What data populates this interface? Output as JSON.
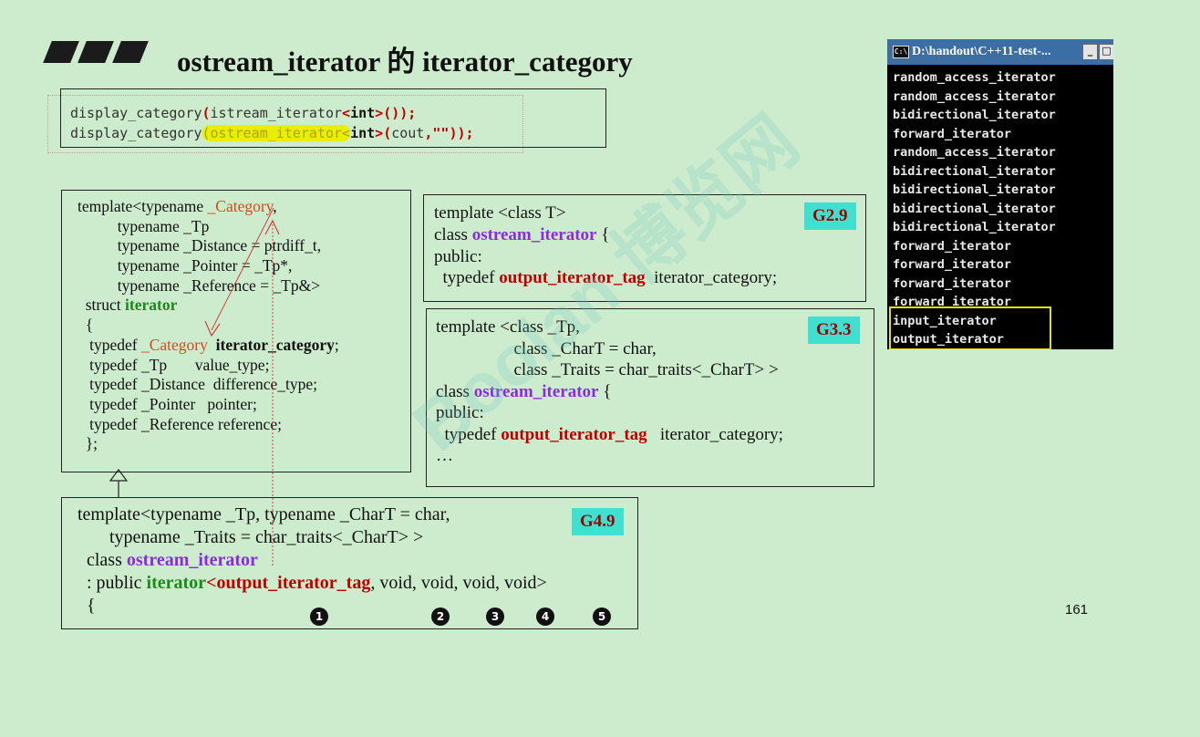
{
  "header": {
    "title": "ostream_iterator 的 iterator_category"
  },
  "calls": {
    "line1": {
      "fn": "display_category",
      "open": "(",
      "type": "istream_iterator",
      "lt": "<",
      "arg": "int",
      "gt": ">",
      "rest": "());"
    },
    "line2": {
      "fn": "display_category",
      "open": "(",
      "type": "ostream_iterator",
      "lt": "<",
      "arg": "int",
      "gt": ">",
      "p1": "(",
      "cout": "cout",
      "comma": ",",
      "str": "\"\"",
      "close": "));"
    }
  },
  "iterator_box": {
    "l1a": "template<typename ",
    "l1b": "_Category",
    ",": ",",
    "l2": "          typename _Tp",
    "l3": "          typename _Distance = ptrdiff_t,",
    "l4": "          typename _Pointer = _Tp*,",
    "l5": "          typename _Reference = _Tp&>",
    "l6a": "  struct ",
    "l6b": "iterator",
    "l7": "  {",
    "l8a": "   typedef ",
    "l8b": "_Category",
    "l8c": "  ",
    "l8d": "iterator_category",
    ";": ";",
    "l9": "   typedef _Tp       value_type;",
    "l10": "   typedef _Distance  difference_type;",
    "l11": "   typedef _Pointer   pointer;",
    "l12": "   typedef _Reference reference;",
    "l13": "  };"
  },
  "g29": {
    "badge": "G2.9",
    "l1": "template <class T>",
    "l2a": "class ",
    "l2b": "ostream_iterator",
    "l2c": " {",
    "l3": "public:",
    "l4a": "  typedef ",
    "l4b": "output_iterator_tag",
    "l4c": "  iterator_category;"
  },
  "g33": {
    "badge": "G3.3",
    "l1": "template <class _Tp,",
    "l2": "                  class _CharT = char,",
    "l3": "                  class _Traits = char_traits<_CharT> >",
    "l4a": "class ",
    "l4b": "ostream_iterator",
    "l4c": " {",
    "l5": "public:",
    "l6a": "  typedef ",
    "l6b": "output_iterator_tag",
    "l6c": "   iterator_category;",
    "l7": "…"
  },
  "g49": {
    "badge": "G4.9",
    "l1": "template<typename _Tp, typename _CharT = char,",
    "l2": "       typename _Traits = char_traits<_CharT> >",
    "l3a": "  class ",
    "l3b": "ostream_iterator",
    "l4a": "  : public ",
    "l4b": "iterator",
    "l4c": "<",
    "l4d": "output_iterator_tag",
    "l4e": ", void, void, void, void>",
    "l5": "  {",
    "markers": [
      "1",
      "2",
      "3",
      "4",
      "5"
    ]
  },
  "console": {
    "title": "D:\\handout\\C++11-test-...",
    "lines": [
      "random_access_iterator",
      "random_access_iterator",
      "bidirectional_iterator",
      "forward_iterator",
      "random_access_iterator",
      "bidirectional_iterator",
      "bidirectional_iterator",
      "bidirectional_iterator",
      "bidirectional_iterator",
      "forward_iterator",
      "forward_iterator",
      "forward_iterator",
      "forward_iterator",
      "input_iterator",
      "output_iterator"
    ]
  },
  "footer": {
    "page": "161"
  },
  "watermark": "Boolan 博览网",
  "colors": {
    "background": "#cdeccd",
    "badge": "#40e0d0",
    "keyword_red": "#c00000",
    "class_purple": "#8a2be2",
    "struct_green": "#1a8a1a",
    "highlight": "#e6f000"
  }
}
